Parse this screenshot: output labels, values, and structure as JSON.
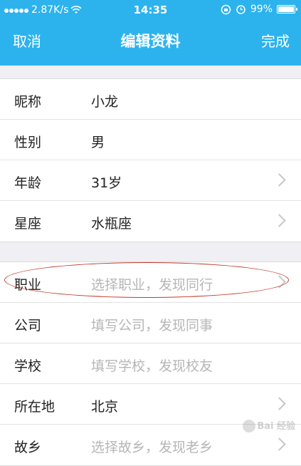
{
  "status_bar": {
    "carrier_speed": "2.87K/s",
    "time": "14:35",
    "battery_percent": "99%",
    "battery_level": 0.99,
    "icons": [
      "signal-dots-icon",
      "wifi-icon",
      "rotation-lock-icon",
      "alarm-icon",
      "battery-icon"
    ]
  },
  "nav": {
    "cancel_label": "取消",
    "title": "编辑资料",
    "done_label": "完成"
  },
  "group1": [
    {
      "label": "昵称",
      "value": "小龙",
      "placeholder": false,
      "has_chevron": false
    },
    {
      "label": "性别",
      "value": "男",
      "placeholder": false,
      "has_chevron": false
    },
    {
      "label": "年龄",
      "value": "31岁",
      "placeholder": false,
      "has_chevron": true
    },
    {
      "label": "星座",
      "value": "水瓶座",
      "placeholder": false,
      "has_chevron": true
    }
  ],
  "group2": [
    {
      "label": "职业",
      "value": "选择职业，发现同行",
      "placeholder": true,
      "has_chevron": true
    },
    {
      "label": "公司",
      "value": "填写公司，发现同事",
      "placeholder": true,
      "has_chevron": false
    },
    {
      "label": "学校",
      "value": "填写学校，发现校友",
      "placeholder": true,
      "has_chevron": false
    },
    {
      "label": "所在地",
      "value": "北京",
      "placeholder": false,
      "has_chevron": true
    },
    {
      "label": "故乡",
      "value": "选择故乡，发现老乡",
      "placeholder": true,
      "has_chevron": true
    }
  ],
  "watermark": {
    "text": "Bai 经验"
  },
  "colors": {
    "header": "#2cb3ee",
    "annotation": "#c0392b",
    "placeholder": "#b6b6b6"
  }
}
